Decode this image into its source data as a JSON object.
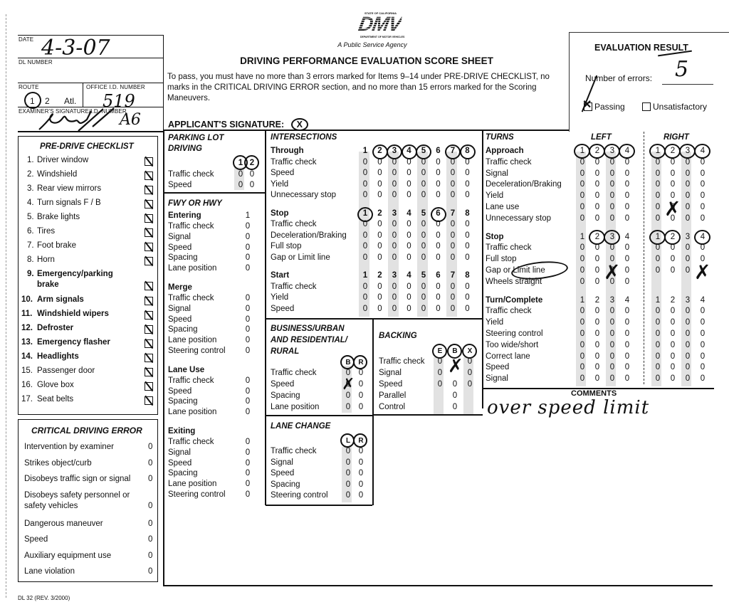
{
  "form": {
    "agency_tagline": "A Public Service Agency",
    "logo_text": "DMV",
    "logo_top": "STATE OF CALIFORNIA",
    "logo_bottom": "DEPARTMENT OF MOTOR VEHICLES",
    "title": "DRIVING PERFORMANCE EVALUATION SCORE SHEET",
    "instructions": "To pass, you must have no more than 3 errors marked for Items 9–14 under PRE-DRIVE CHECKLIST, no marks in the CRITICAL DRIVING ERROR section, and no more than 15 errors marked for the Scoring Maneuvers.",
    "applicant_signature_label": "APPLICANT'S SIGNATURE:",
    "applicant_signature_value": "X",
    "form_number": "DL 32 (REV. 3/2000)"
  },
  "header": {
    "date_label": "DATE",
    "date_value": "4-3-07",
    "dl_number_label": "DL NUMBER",
    "dl_number_value": "",
    "route_label": "ROUTE",
    "route_options": [
      "1",
      "2",
      "Atl."
    ],
    "route_selected": "1",
    "office_id_label": "OFFICE I.D. NUMBER",
    "office_id_value": "519",
    "examiner_label": "EXAMINER'S SIGNATURE/I.D. NUMBER",
    "examiner_id_value": "A6"
  },
  "evaluation": {
    "title": "EVALUATION RESULT",
    "errors_label": "Number of errors:",
    "errors_value": "5",
    "passing_label": "Passing",
    "passing_checked": true,
    "unsatisfactory_label": "Unsatisfactory",
    "unsatisfactory_checked": false
  },
  "predrive": {
    "title": "PRE-DRIVE CHECKLIST",
    "items": [
      {
        "n": "1.",
        "label": "Driver window",
        "bold": false,
        "checked": true
      },
      {
        "n": "2.",
        "label": "Windshield",
        "bold": false,
        "checked": true
      },
      {
        "n": "3.",
        "label": "Rear view mirrors",
        "bold": false,
        "checked": true
      },
      {
        "n": "4.",
        "label": "Turn signals    F / B",
        "bold": false,
        "checked": true
      },
      {
        "n": "5.",
        "label": "Brake lights",
        "bold": false,
        "checked": true
      },
      {
        "n": "6.",
        "label": "Tires",
        "bold": false,
        "checked": true
      },
      {
        "n": "7.",
        "label": "Foot brake",
        "bold": false,
        "checked": true
      },
      {
        "n": "8.",
        "label": "Horn",
        "bold": false,
        "checked": true
      },
      {
        "n": "9.",
        "label": "Emergency/parking",
        "label2": "brake",
        "bold": true,
        "checked": true
      },
      {
        "n": "10.",
        "label": "Arm signals",
        "bold": true,
        "checked": true
      },
      {
        "n": "11.",
        "label": "Windshield wipers",
        "bold": true,
        "checked": true
      },
      {
        "n": "12.",
        "label": "Defroster",
        "bold": true,
        "checked": true
      },
      {
        "n": "13.",
        "label": "Emergency flasher",
        "bold": true,
        "checked": true
      },
      {
        "n": "14.",
        "label": "Headlights",
        "bold": true,
        "checked": true
      },
      {
        "n": "15.",
        "label": "Passenger door",
        "bold": false,
        "checked": true
      },
      {
        "n": "16.",
        "label": "Glove box",
        "bold": false,
        "checked": true
      },
      {
        "n": "17.",
        "label": "Seat belts",
        "bold": false,
        "checked": true
      }
    ]
  },
  "critical": {
    "title": "CRITICAL DRIVING ERROR",
    "items": [
      {
        "label": "Intervention by examiner",
        "value": "0"
      },
      {
        "label": "Strikes object/curb",
        "value": "0"
      },
      {
        "label": "Disobeys traffic sign or signal",
        "value": "0"
      },
      {
        "label": "Disobeys safety personnel or",
        "label2": "safety vehicles",
        "value": "0"
      },
      {
        "label": "Dangerous maneuver",
        "value": "0"
      },
      {
        "label": "Speed",
        "value": "0"
      },
      {
        "label": "Auxiliary equipment use",
        "value": "0"
      },
      {
        "label": "Lane violation",
        "value": "0"
      }
    ]
  },
  "parking_lot": {
    "title1": "PARKING LOT",
    "title2": "DRIVING",
    "columns": [
      "1",
      "2"
    ],
    "circled": [
      "1",
      "2"
    ],
    "rows": [
      {
        "label": "Traffic check",
        "values": [
          "0",
          "0"
        ]
      },
      {
        "label": "Speed",
        "values": [
          "0",
          "0"
        ]
      }
    ]
  },
  "freeway": {
    "title": "FWY OR HWY",
    "groups": [
      {
        "name": "Entering",
        "col": "1",
        "rows": [
          {
            "label": "Traffic check",
            "value": "0"
          },
          {
            "label": "Signal",
            "value": "0"
          },
          {
            "label": "Speed",
            "value": "0"
          },
          {
            "label": "Spacing",
            "value": "0"
          },
          {
            "label": "Lane position",
            "value": "0"
          }
        ]
      },
      {
        "name": "Merge",
        "rows": [
          {
            "label": "Traffic check",
            "value": "0"
          },
          {
            "label": "Signal",
            "value": "0"
          },
          {
            "label": "Speed",
            "value": "0"
          },
          {
            "label": "Spacing",
            "value": "0"
          },
          {
            "label": "Lane position",
            "value": "0"
          },
          {
            "label": "Steering control",
            "value": "0"
          }
        ]
      },
      {
        "name": "Lane Use",
        "rows": [
          {
            "label": "Traffic check",
            "value": "0"
          },
          {
            "label": "Speed",
            "value": "0"
          },
          {
            "label": "Spacing",
            "value": "0"
          },
          {
            "label": "Lane position",
            "value": "0"
          }
        ]
      },
      {
        "name": "Exiting",
        "rows": [
          {
            "label": "Traffic check",
            "value": "0"
          },
          {
            "label": "Signal",
            "value": "0"
          },
          {
            "label": "Speed",
            "value": "0"
          },
          {
            "label": "Spacing",
            "value": "0"
          },
          {
            "label": "Lane position",
            "value": "0"
          },
          {
            "label": "Steering control",
            "value": "0"
          }
        ]
      }
    ]
  },
  "intersections": {
    "title": "INTERSECTIONS",
    "groups": [
      {
        "name": "Through",
        "columns": [
          "1",
          "2",
          "3",
          "4",
          "5",
          "6",
          "7",
          "8"
        ],
        "circled": [
          "2",
          "3",
          "4",
          "5",
          "7",
          "8"
        ],
        "rows": [
          {
            "label": "Traffic check",
            "values": [
              "0",
              "0",
              "0",
              "0",
              "0",
              "0",
              "0",
              "0"
            ]
          },
          {
            "label": "Speed",
            "values": [
              "0",
              "0",
              "0",
              "0",
              "0",
              "0",
              "0",
              "0"
            ]
          },
          {
            "label": "Yield",
            "values": [
              "0",
              "0",
              "0",
              "0",
              "0",
              "0",
              "0",
              "0"
            ]
          },
          {
            "label": "Unnecessary stop",
            "values": [
              "0",
              "0",
              "0",
              "0",
              "0",
              "0",
              "0",
              "0"
            ]
          }
        ]
      },
      {
        "name": "Stop",
        "columns": [
          "1",
          "2",
          "3",
          "4",
          "5",
          "6",
          "7",
          "8"
        ],
        "circled": [
          "1",
          "6"
        ],
        "rows": [
          {
            "label": "Traffic check",
            "values": [
              "0",
              "0",
              "0",
              "0",
              "0",
              "0",
              "0",
              "0"
            ]
          },
          {
            "label": "Deceleration/Braking",
            "values": [
              "0",
              "0",
              "0",
              "0",
              "0",
              "0",
              "0",
              "0"
            ]
          },
          {
            "label": "Full stop",
            "values": [
              "0",
              "0",
              "0",
              "0",
              "0",
              "0",
              "0",
              "0"
            ]
          },
          {
            "label": "Gap or Limit line",
            "values": [
              "0",
              "0",
              "0",
              "0",
              "0",
              "0",
              "0",
              "0"
            ]
          }
        ]
      },
      {
        "name": "Start",
        "columns": [
          "1",
          "2",
          "3",
          "4",
          "5",
          "6",
          "7",
          "8"
        ],
        "circled": [],
        "rows": [
          {
            "label": "Traffic check",
            "values": [
              "0",
              "0",
              "0",
              "0",
              "0",
              "0",
              "0",
              "0"
            ]
          },
          {
            "label": "Yield",
            "values": [
              "0",
              "0",
              "0",
              "0",
              "0",
              "0",
              "0",
              "0"
            ]
          },
          {
            "label": "Speed",
            "values": [
              "0",
              "0",
              "0",
              "0",
              "0",
              "0",
              "0",
              "0"
            ]
          }
        ]
      }
    ]
  },
  "business": {
    "title1": "BUSINESS/URBAN",
    "title2": "AND RESIDENTIAL/",
    "title3": "RURAL",
    "columns": [
      "B",
      "R"
    ],
    "circled": [
      "B",
      "R"
    ],
    "rows": [
      {
        "label": "Traffic check",
        "values": [
          "0",
          "0"
        ]
      },
      {
        "label": "Speed",
        "values": [
          "0",
          "0"
        ],
        "marked": [
          "B"
        ]
      },
      {
        "label": "Spacing",
        "values": [
          "0",
          "0"
        ]
      },
      {
        "label": "Lane position",
        "values": [
          "0",
          "0"
        ]
      }
    ]
  },
  "backing": {
    "title": "BACKING",
    "columns": [
      "E",
      "B",
      "X"
    ],
    "circled": [
      "E",
      "B",
      "X"
    ],
    "rows": [
      {
        "label": "Traffic check",
        "values": [
          "0",
          "",
          "0"
        ],
        "marked": [
          "B"
        ]
      },
      {
        "label": "Signal",
        "values": [
          "0",
          "",
          "0"
        ]
      },
      {
        "label": "Speed",
        "values": [
          "0",
          "0",
          "0"
        ]
      },
      {
        "label": "Parallel",
        "values": [
          "",
          "0",
          ""
        ]
      },
      {
        "label": "Control",
        "values": [
          "",
          "0",
          ""
        ]
      }
    ]
  },
  "lane_change": {
    "title": "LANE CHANGE",
    "columns": [
      "L",
      "R"
    ],
    "circled": [
      "L",
      "R"
    ],
    "rows": [
      {
        "label": "Traffic check",
        "values": [
          "0",
          "0"
        ]
      },
      {
        "label": "Signal",
        "values": [
          "0",
          "0"
        ]
      },
      {
        "label": "Speed",
        "values": [
          "0",
          "0"
        ]
      },
      {
        "label": "Spacing",
        "values": [
          "0",
          "0"
        ]
      },
      {
        "label": "Steering control",
        "values": [
          "0",
          "0"
        ]
      }
    ]
  },
  "turns": {
    "title": "TURNS",
    "left_label": "LEFT",
    "right_label": "RIGHT",
    "groups": [
      {
        "name": "Approach",
        "columns": [
          "1",
          "2",
          "3",
          "4"
        ],
        "left_circled": [
          "1",
          "2",
          "3",
          "4"
        ],
        "right_circled": [
          "1",
          "2",
          "3",
          "4"
        ],
        "rows": [
          {
            "label": "Traffic check",
            "left": [
              "0",
              "0",
              "0",
              "0"
            ],
            "right": [
              "0",
              "0",
              "0",
              "0"
            ]
          },
          {
            "label": "Signal",
            "left": [
              "0",
              "0",
              "0",
              "0"
            ],
            "right": [
              "0",
              "0",
              "0",
              "0"
            ]
          },
          {
            "label": "Deceleration/Braking",
            "left": [
              "0",
              "0",
              "0",
              "0"
            ],
            "right": [
              "0",
              "0",
              "0",
              "0"
            ]
          },
          {
            "label": "Yield",
            "left": [
              "0",
              "0",
              "0",
              "0"
            ],
            "right": [
              "0",
              "0",
              "0",
              "0"
            ]
          },
          {
            "label": "Lane use",
            "left": [
              "0",
              "0",
              "0",
              "0"
            ],
            "right": [
              "0",
              "0",
              "0",
              "0"
            ],
            "right_marked": [
              "2"
            ]
          },
          {
            "label": "Unnecessary stop",
            "left": [
              "0",
              "0",
              "0",
              "0"
            ],
            "right": [
              "0",
              "0",
              "0",
              "0"
            ]
          }
        ]
      },
      {
        "name": "Stop",
        "columns": [
          "1",
          "2",
          "3",
          "4"
        ],
        "left_circled": [
          "2",
          "3"
        ],
        "right_circled": [
          "1",
          "2",
          "4"
        ],
        "rows": [
          {
            "label": "Traffic check",
            "left": [
              "0",
              "0",
              "0",
              "0"
            ],
            "right": [
              "0",
              "0",
              "0",
              "0"
            ]
          },
          {
            "label": "Full stop",
            "left": [
              "0",
              "0",
              "0",
              "0"
            ],
            "right": [
              "0",
              "0",
              "0",
              "0"
            ]
          },
          {
            "label": "Gap or Limit line",
            "left": [
              "0",
              "0",
              "0",
              "0"
            ],
            "right": [
              "0",
              "0",
              "0",
              ""
            ],
            "left_marked": [
              "3"
            ],
            "right_marked": [
              "4"
            ],
            "label_circled": true
          },
          {
            "label": "Wheels straight",
            "left": [
              "0",
              "0",
              "0",
              "0"
            ],
            "right": [
              "",
              "",
              "",
              ""
            ]
          }
        ]
      },
      {
        "name": "Turn/Complete",
        "columns": [
          "1",
          "2",
          "3",
          "4"
        ],
        "left_circled": [],
        "right_circled": [],
        "rows": [
          {
            "label": "Traffic check",
            "left": [
              "0",
              "0",
              "0",
              "0"
            ],
            "right": [
              "0",
              "0",
              "0",
              "0"
            ]
          },
          {
            "label": "Yield",
            "left": [
              "0",
              "0",
              "0",
              "0"
            ],
            "right": [
              "0",
              "0",
              "0",
              "0"
            ]
          },
          {
            "label": "Steering control",
            "left": [
              "0",
              "0",
              "0",
              "0"
            ],
            "right": [
              "0",
              "0",
              "0",
              "0"
            ]
          },
          {
            "label": "Too wide/short",
            "left": [
              "0",
              "0",
              "0",
              "0"
            ],
            "right": [
              "0",
              "0",
              "0",
              "0"
            ]
          },
          {
            "label": "Correct lane",
            "left": [
              "0",
              "0",
              "0",
              "0"
            ],
            "right": [
              "0",
              "0",
              "0",
              "0"
            ]
          },
          {
            "label": "Speed",
            "left": [
              "0",
              "0",
              "0",
              "0"
            ],
            "right": [
              "0",
              "0",
              "0",
              "0"
            ]
          },
          {
            "label": "Signal",
            "left": [
              "0",
              "0",
              "0",
              "0"
            ],
            "right": [
              "0",
              "0",
              "0",
              "0"
            ]
          }
        ]
      }
    ]
  },
  "comments": {
    "title": "COMMENTS",
    "text": "over speed limit"
  }
}
